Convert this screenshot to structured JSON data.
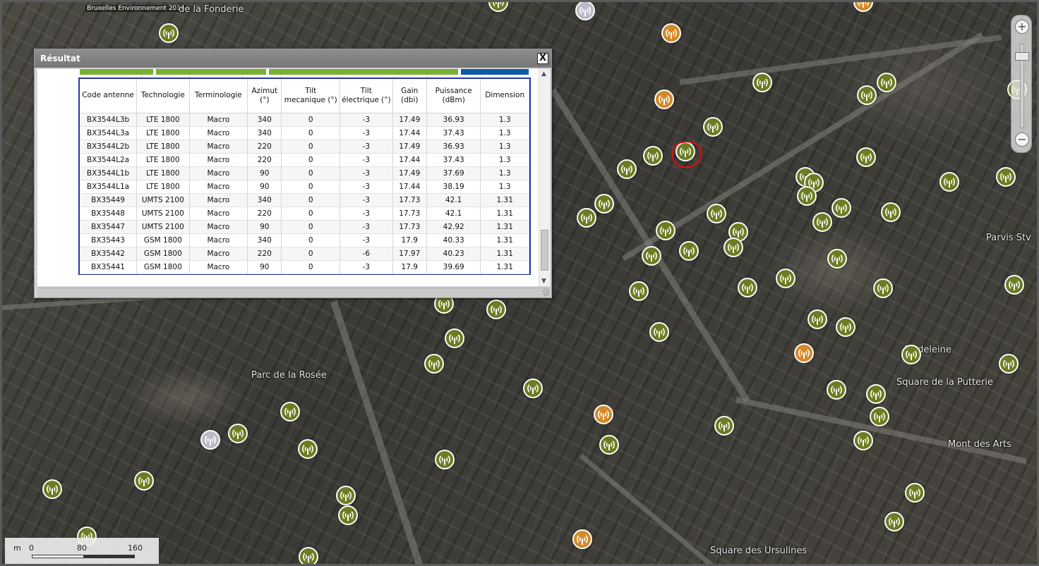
{
  "map": {
    "attribution": "Bruxelles Environnement 2016",
    "labels": {
      "fonderie": "de la Fonderie",
      "parvis": "Parvis Stv",
      "rosee": "Parc de la Rosée",
      "madeleine": "Madeleine",
      "putterie": "Square de la Putterie",
      "monts": "Mont des Arts",
      "ursulines": "Square des Ursulines"
    },
    "marker_icon": "antenna-icon",
    "marker_colors": {
      "green": "#6b7d22",
      "orange": "#d38a2a",
      "white": "#b9bcc6"
    },
    "highlight_color": "#e01010"
  },
  "zoom": {
    "in_label": "+",
    "out_label": "−"
  },
  "scale": {
    "unit": "m",
    "ticks": [
      "0",
      "80",
      "160"
    ]
  },
  "result_window": {
    "title": "Résultat",
    "close_label": "X",
    "columns": [
      "Code antenne",
      "Technologie",
      "Terminologie",
      "Azimut (°)",
      "Tilt mecanique (°)",
      "Tilt électrique (°)",
      "Gain (dbi)",
      "Puissance (dBm)",
      "Dimension"
    ],
    "rows": [
      [
        "BX3544L3b",
        "LTE 1800",
        "Macro",
        "340",
        "0",
        "-3",
        "17.49",
        "36.93",
        "1.3"
      ],
      [
        "BX3544L3a",
        "LTE 1800",
        "Macro",
        "340",
        "0",
        "-3",
        "17.44",
        "37.43",
        "1.3"
      ],
      [
        "BX3544L2b",
        "LTE 1800",
        "Macro",
        "220",
        "0",
        "-3",
        "17.49",
        "36.93",
        "1.3"
      ],
      [
        "BX3544L2a",
        "LTE 1800",
        "Macro",
        "220",
        "0",
        "-3",
        "17.44",
        "37.43",
        "1.3"
      ],
      [
        "BX3544L1b",
        "LTE 1800",
        "Macro",
        "90",
        "0",
        "-3",
        "17.49",
        "37.69",
        "1.3"
      ],
      [
        "BX3544L1a",
        "LTE 1800",
        "Macro",
        "90",
        "0",
        "-3",
        "17.44",
        "38.19",
        "1.3"
      ],
      [
        "BX35449",
        "UMTS 2100",
        "Macro",
        "340",
        "0",
        "-3",
        "17.73",
        "42.1",
        "1.31"
      ],
      [
        "BX35448",
        "UMTS 2100",
        "Macro",
        "220",
        "0",
        "-3",
        "17.73",
        "42.1",
        "1.31"
      ],
      [
        "BX35447",
        "UMTS 2100",
        "Macro",
        "90",
        "0",
        "-3",
        "17.73",
        "42.92",
        "1.31"
      ],
      [
        "BX35443",
        "GSM 1800",
        "Macro",
        "340",
        "0",
        "-3",
        "17.9",
        "40.33",
        "1.31"
      ],
      [
        "BX35442",
        "GSM 1800",
        "Macro",
        "220",
        "0",
        "-6",
        "17.97",
        "40.23",
        "1.31"
      ],
      [
        "BX35441",
        "GSM 1800",
        "Macro",
        "90",
        "0",
        "-3",
        "17.9",
        "39.69",
        "1.31"
      ]
    ]
  }
}
